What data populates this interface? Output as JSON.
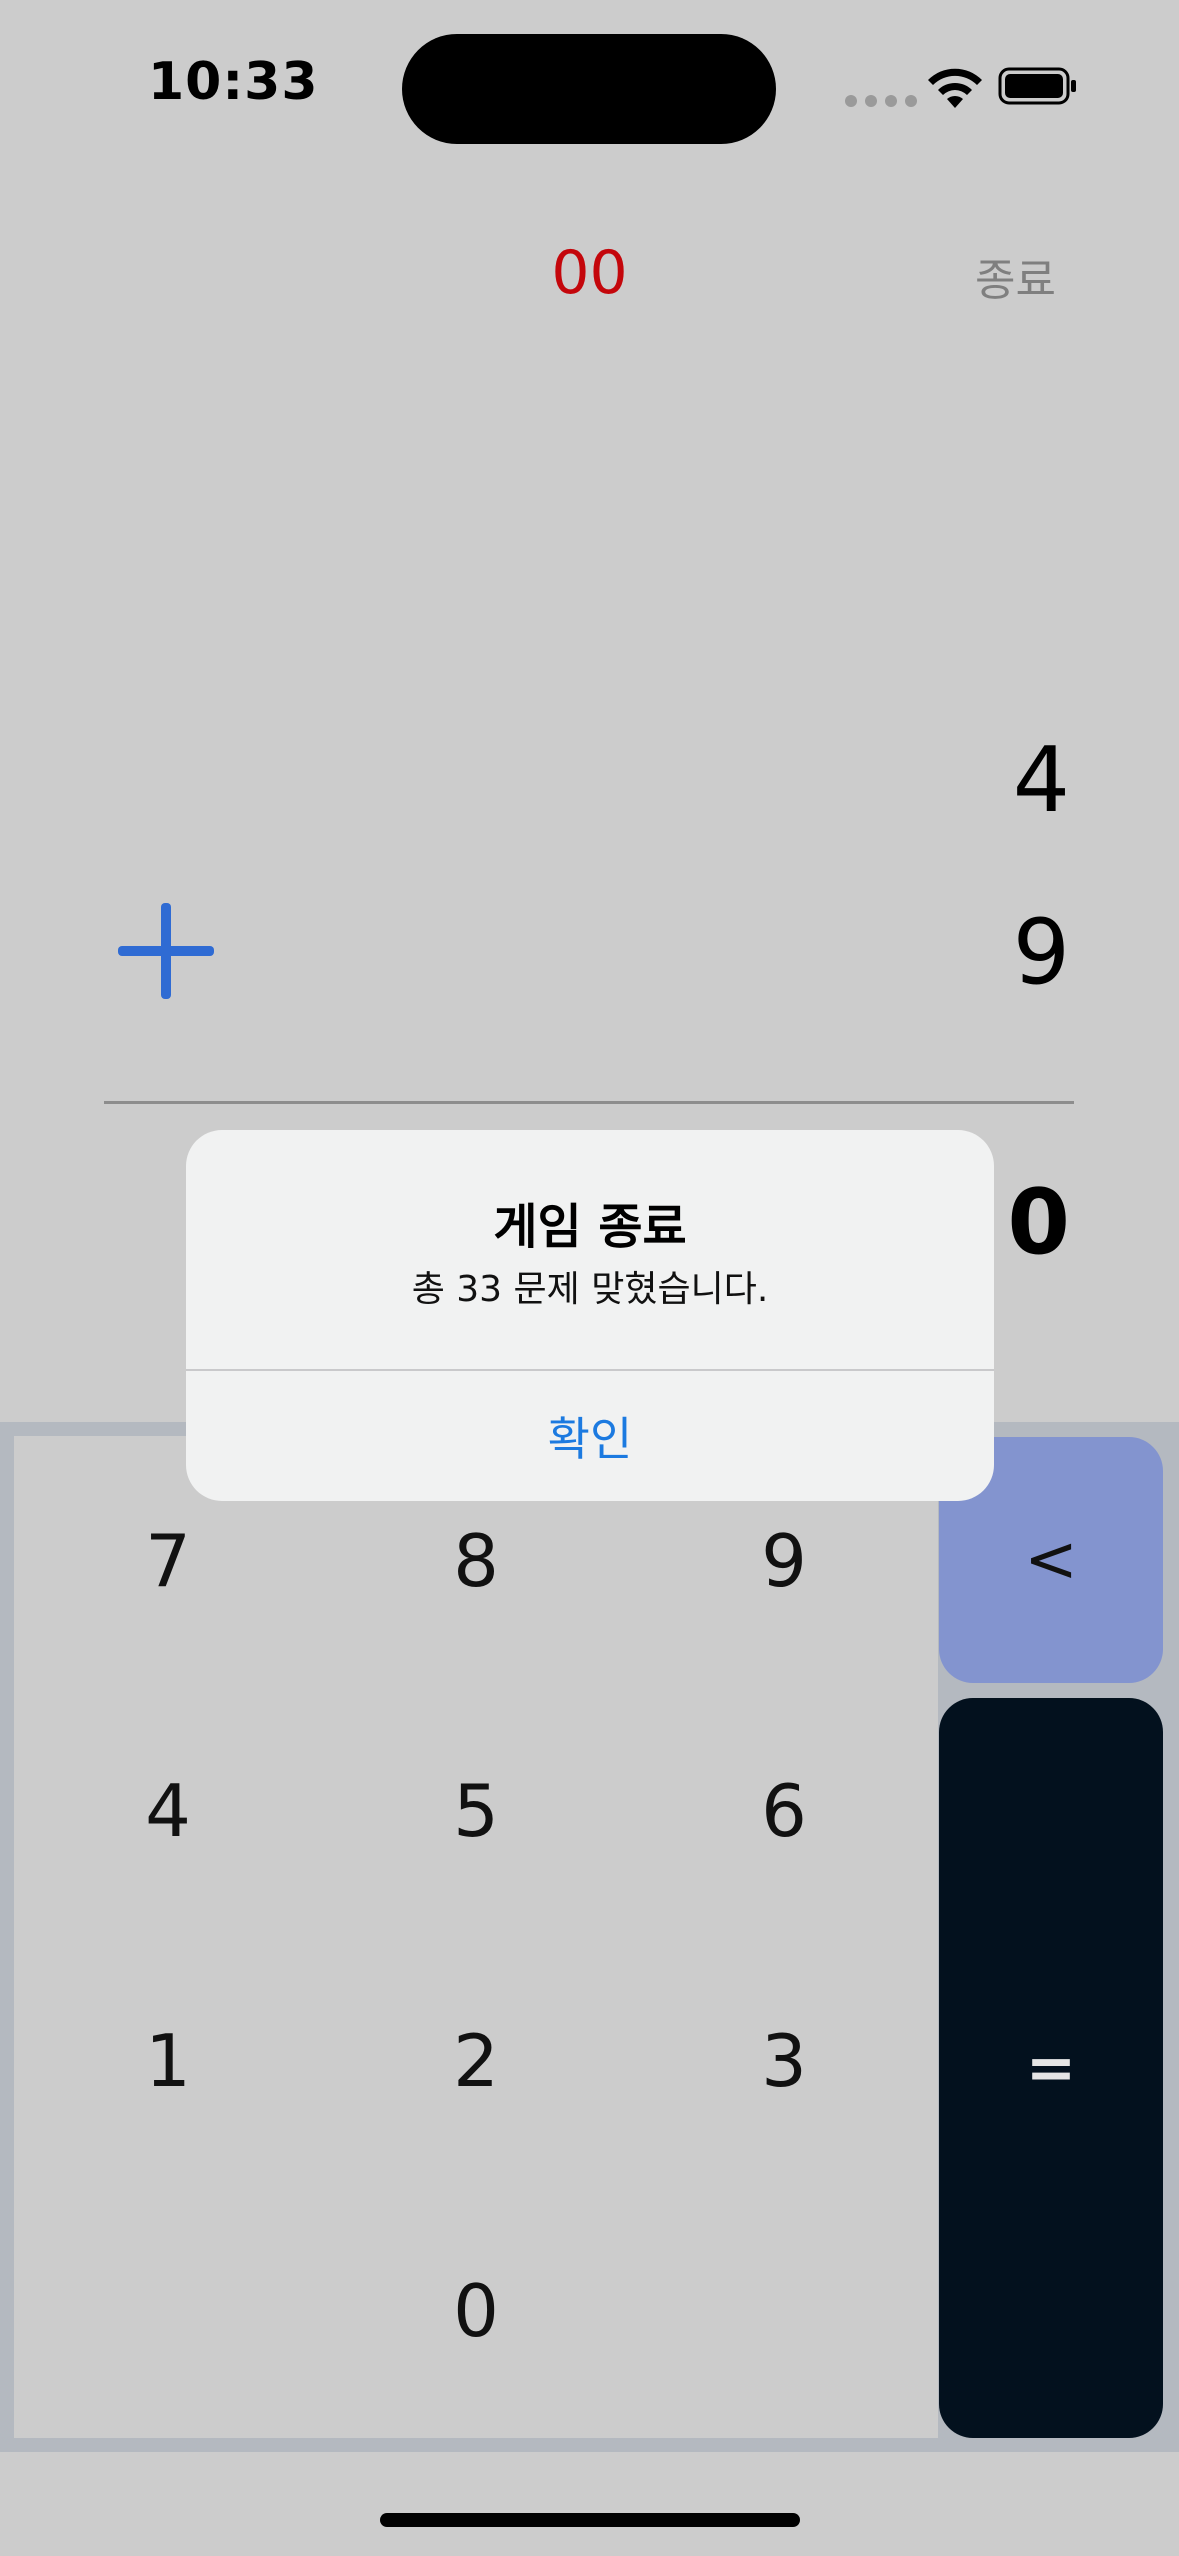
{
  "status_bar": {
    "time": "10:33"
  },
  "header": {
    "timer": "00",
    "end_label": "종료"
  },
  "problem": {
    "operand1": "4",
    "operand2": "9",
    "operator": "plus",
    "answer": "0"
  },
  "keypad": {
    "keys": [
      "7",
      "8",
      "9",
      "4",
      "5",
      "6",
      "1",
      "2",
      "3",
      "0"
    ],
    "backspace": "<",
    "equals": "="
  },
  "alert": {
    "title": "게임 종료",
    "message": "총 33 문제 맞혔습니다.",
    "confirm": "확인"
  },
  "colors": {
    "background": "#cccccc",
    "timer": "#c4060b",
    "plus": "#2f6bd3",
    "backspace_key": "#8394cf",
    "equals_key": "#03111e",
    "alert_button": "#1c7ae0"
  }
}
